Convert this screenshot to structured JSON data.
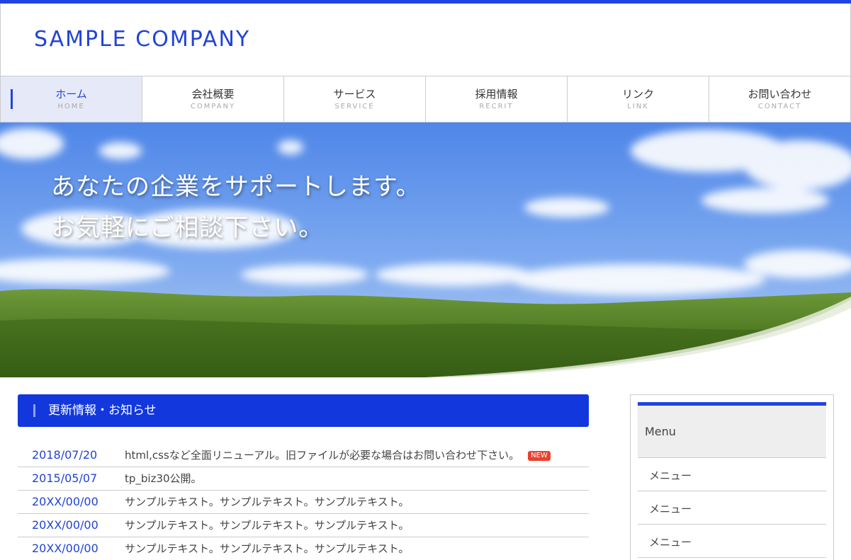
{
  "header": {
    "logo": "SAMPLE COMPANY"
  },
  "nav": [
    {
      "jp": "ホーム",
      "en": "HOME"
    },
    {
      "jp": "会社概要",
      "en": "COMPANY"
    },
    {
      "jp": "サービス",
      "en": "SERVICE"
    },
    {
      "jp": "採用情報",
      "en": "RECRIT"
    },
    {
      "jp": "リンク",
      "en": "LINK"
    },
    {
      "jp": "お問い合わせ",
      "en": "CONTACT"
    }
  ],
  "hero": {
    "line1": "あなたの企業をサポートします。",
    "line2": "お気軽にご相談下さい。"
  },
  "news": {
    "title": "更新情報・お知らせ",
    "new_badge": "NEW",
    "items": [
      {
        "date": "2018/07/20",
        "text": "html,cssなど全面リニューアル。旧ファイルが必要な場合はお問い合わせ下さい。"
      },
      {
        "date": "2015/05/07",
        "text": "tp_biz30公開。"
      },
      {
        "date": "20XX/00/00",
        "text": "サンプルテキスト。サンプルテキスト。サンプルテキスト。"
      },
      {
        "date": "20XX/00/00",
        "text": "サンプルテキスト。サンプルテキスト。サンプルテキスト。"
      },
      {
        "date": "20XX/00/00",
        "text": "サンプルテキスト。サンプルテキスト。サンプルテキスト。"
      }
    ]
  },
  "sidebar": {
    "title": "Menu",
    "items": [
      "メニュー",
      "メニュー",
      "メニュー"
    ]
  },
  "colors": {
    "accent": "#2144e0",
    "news_header": "#1238dd",
    "badge": "#e8422f"
  }
}
